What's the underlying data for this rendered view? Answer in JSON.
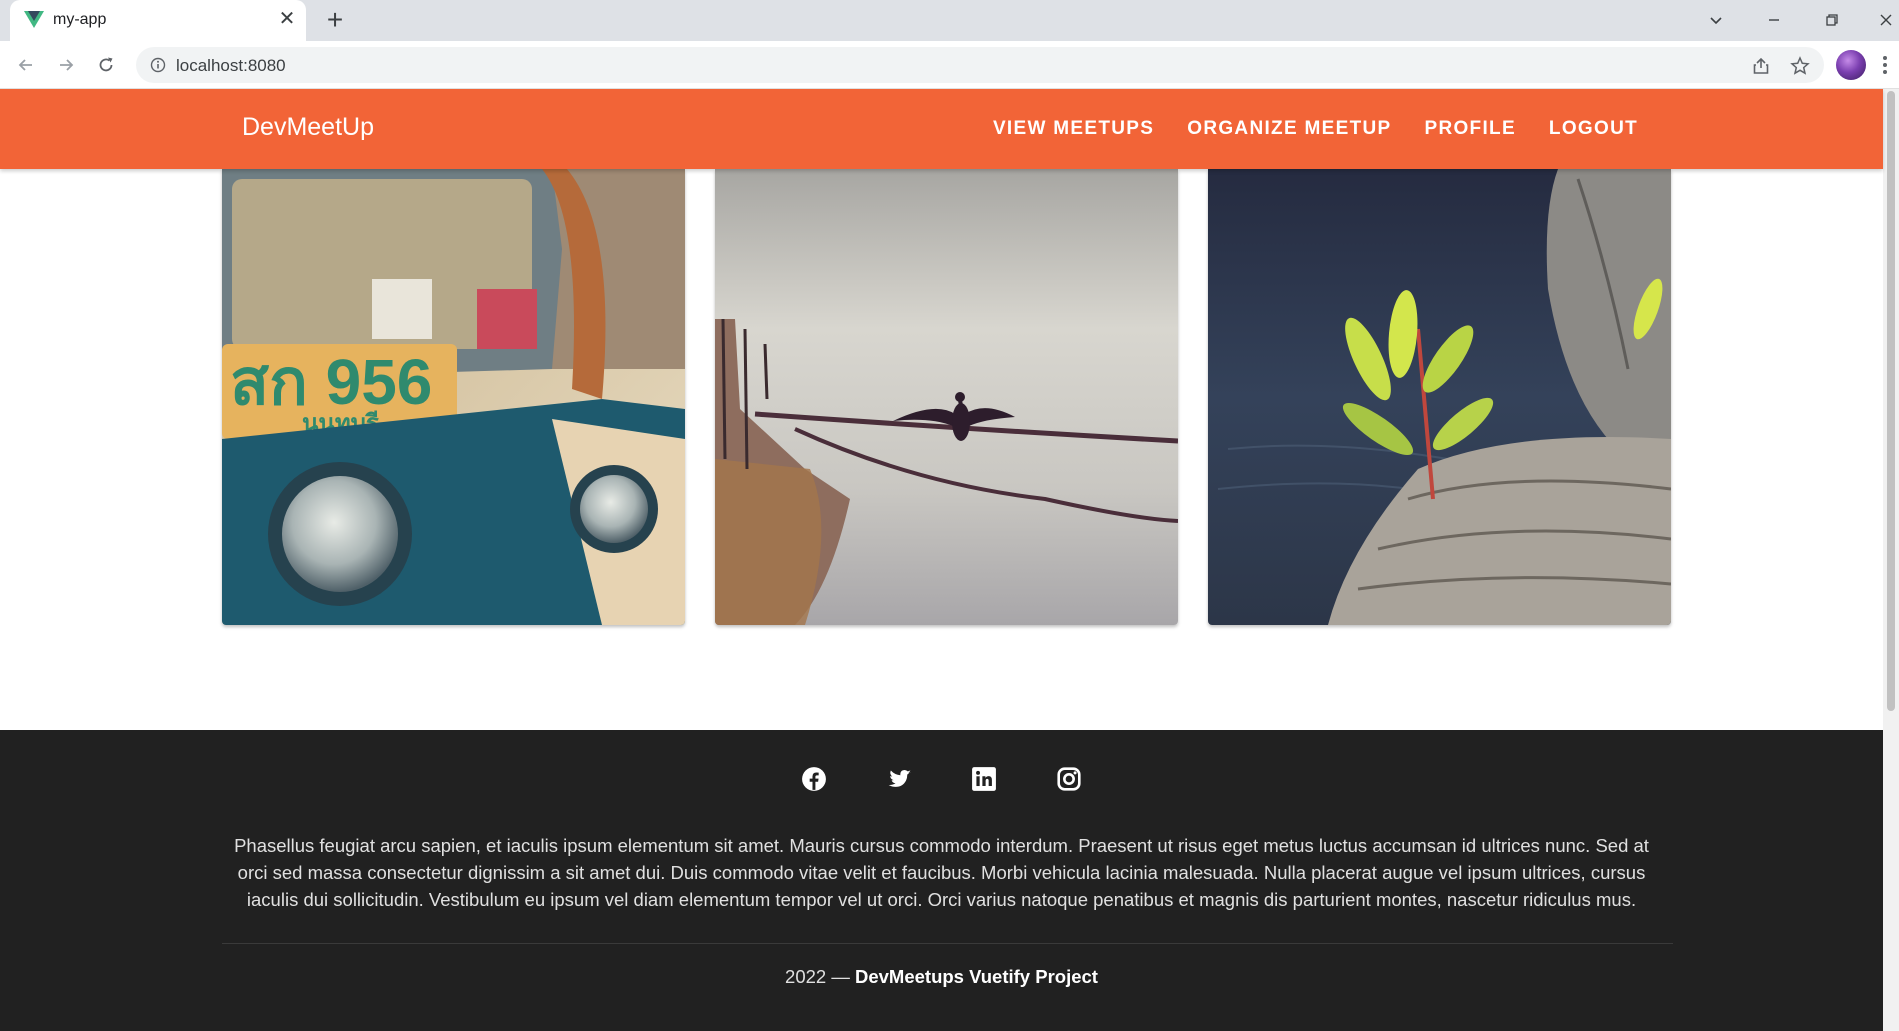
{
  "browser": {
    "tab_title": "my-app",
    "tab_close_glyph": "✕",
    "new_tab_glyph": "+",
    "url": "localhost:8080",
    "icons": [
      "vue-favicon-icon",
      "close-icon",
      "plus-icon",
      "chevron-down-icon",
      "minimize-icon",
      "restore-icon",
      "window-close-icon",
      "back-arrow-icon",
      "forward-arrow-icon",
      "reload-icon",
      "info-icon",
      "share-icon",
      "star-icon",
      "profile-avatar",
      "more-vert-icon"
    ]
  },
  "app": {
    "brand": "DevMeetUp",
    "accent_color": "#f26437",
    "nav": [
      {
        "label": "View Meetups"
      },
      {
        "label": "Organize Meetup"
      },
      {
        "label": "Profile"
      },
      {
        "label": "Logout"
      }
    ]
  },
  "cards": [
    {
      "image": "tuk-tuk-headlights-photo"
    },
    {
      "image": "cormorant-on-rope-photo"
    },
    {
      "image": "plant-on-rock-photo"
    }
  ],
  "footer": {
    "background_color": "#212121",
    "social_icons": [
      "facebook-icon",
      "twitter-icon",
      "linkedin-icon",
      "instagram-icon"
    ],
    "text": "Phasellus feugiat arcu sapien, et iaculis ipsum elementum sit amet. Mauris cursus commodo interdum. Praesent ut risus eget metus luctus accumsan id ultrices nunc. Sed at orci sed massa consectetur dignissim a sit amet dui. Duis commodo vitae velit et faucibus. Morbi vehicula lacinia malesuada. Nulla placerat augue vel ipsum ultrices, cursus iaculis dui sollicitudin. Vestibulum eu ipsum vel diam elementum tempor vel ut orci. Orci varius natoque penatibus et magnis dis parturient montes, nascetur ridiculus mus.",
    "year": "2022 —",
    "project": "DevMeetups Vuetify Project"
  }
}
